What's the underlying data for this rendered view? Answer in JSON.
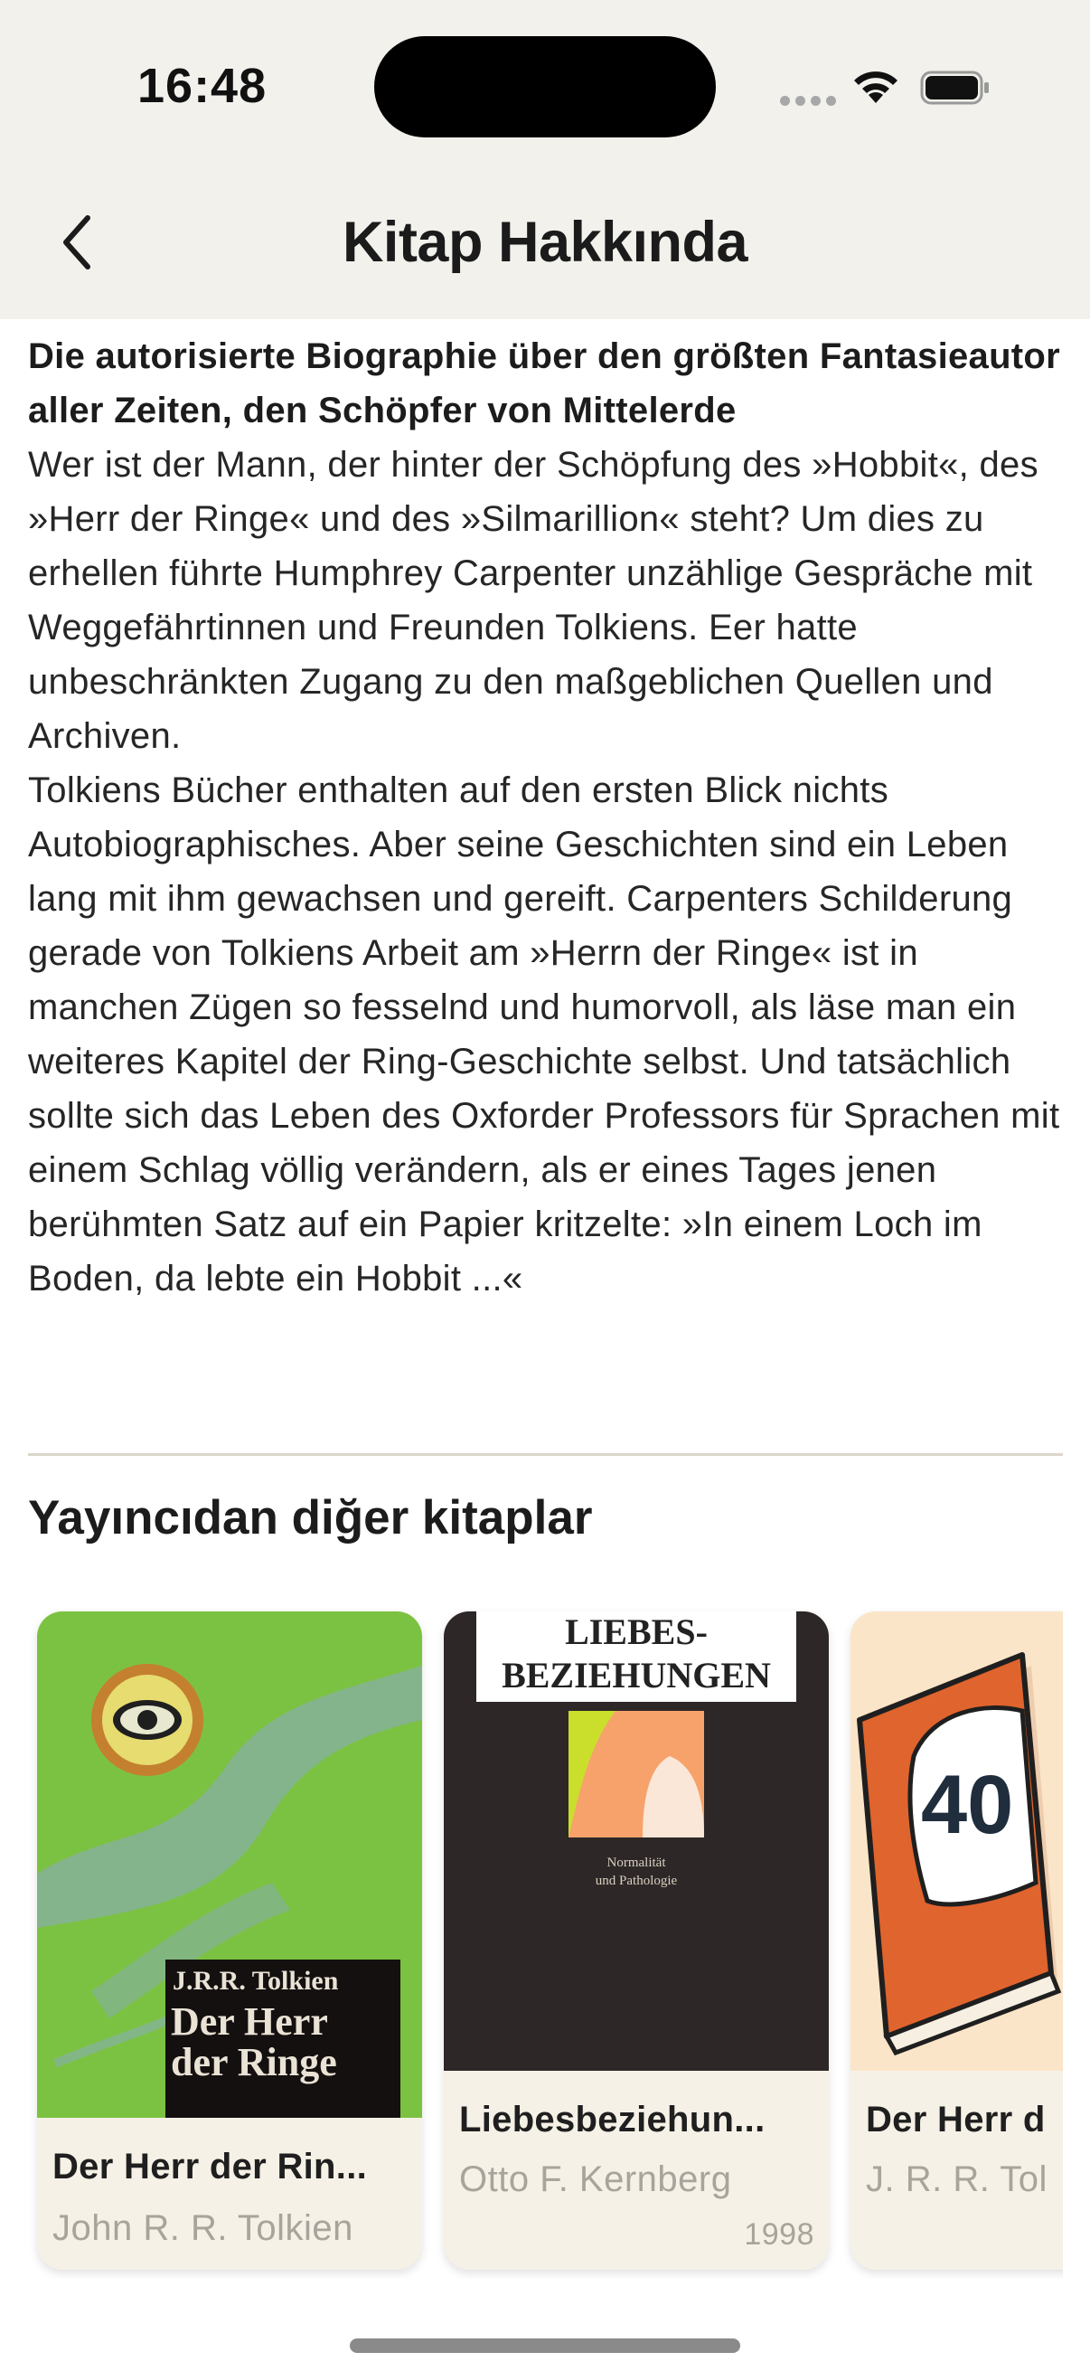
{
  "status_bar": {
    "time": "16:48",
    "wifi_icon": "wifi-icon",
    "battery_icon": "battery-icon"
  },
  "header": {
    "title": "Kitap Hakkında",
    "back_icon": "chevron-left-icon"
  },
  "description": {
    "headline": "Die autorisierte Biographie über den größten Fantasieautor aller Zeiten, den Schöpfer von Mittelerde",
    "paragraph_1": "Wer ist der Mann, der hinter der Schöpfung des »Hobbit«, des »Herr der Ringe« und des »Silmarillion« steht? Um dies zu erhellen führte Humphrey Carpenter unzählige Gespräche mit Weggefährtinnen und Freunden Tolkiens. Eer hatte unbeschränkten Zugang zu den maßgeblichen Quellen und Archiven.",
    "paragraph_2": "Tolkiens Bücher enthalten auf den ersten Blick nichts Autobiographisches. Aber seine Geschichten sind ein Leben lang mit ihm gewachsen und gereift. Carpenters Schilderung gerade von Tolkiens Arbeit am »Herrn der Ringe« ist in manchen Zügen so fesselnd und humorvoll, als läse man ein weiteres Kapitel der Ring-Geschichte selbst. Und tatsächlich sollte sich das Leben des Oxforder Professors für Sprachen mit einem Schlag völlig verändern, als er eines Tages jenen berühmten Satz auf ein Papier kritzelte: »In einem Loch im Boden, da lebte ein Hobbit ...«"
  },
  "other_books": {
    "section_title": "Yayıncıdan diğer kitaplar",
    "books": [
      {
        "title": "Der Herr der Rin...",
        "author": "John R. R. Tolkien",
        "year": "",
        "cover_text": [
          "J.R.R. Tolkien",
          "Der Herr",
          "der Ringe"
        ],
        "cover_color": "#7cc242"
      },
      {
        "title": "Liebesbeziehun...",
        "author": "Otto F. Kernberg",
        "year": "1998",
        "cover_text": [
          "LIEBES-",
          "BEZIEHUNGEN",
          "Normalität",
          "und Pathologie"
        ],
        "cover_color": "#2e2727"
      },
      {
        "title": "Der Herr d",
        "author": "J. R. R. Tol",
        "year": "",
        "cover_text": [
          "40"
        ],
        "cover_color": "#fbe5c8"
      }
    ]
  }
}
